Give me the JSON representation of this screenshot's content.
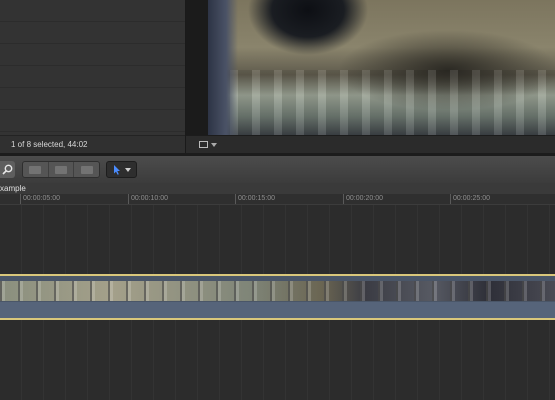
{
  "browser": {
    "status_text": "1 of 8 selected, 44:02"
  },
  "timeline_index": {
    "project_name": "xample"
  },
  "ruler": {
    "timecodes": [
      "00:00:05:00",
      "00:00:10:00",
      "00:00:15:00",
      "00:00:20:00",
      "00:00:25:00"
    ]
  },
  "colors": {
    "clip_border": "#d9c77b",
    "clip_fill": "#4a5668",
    "tool_accent": "#4a8cff"
  },
  "icons": {
    "zoom": "magnifier-icon",
    "crop": "crop-icon",
    "select_tool": "arrow-pointer-icon",
    "edit_buttons": [
      "connect-clip-icon",
      "insert-clip-icon",
      "append-clip-icon"
    ]
  }
}
